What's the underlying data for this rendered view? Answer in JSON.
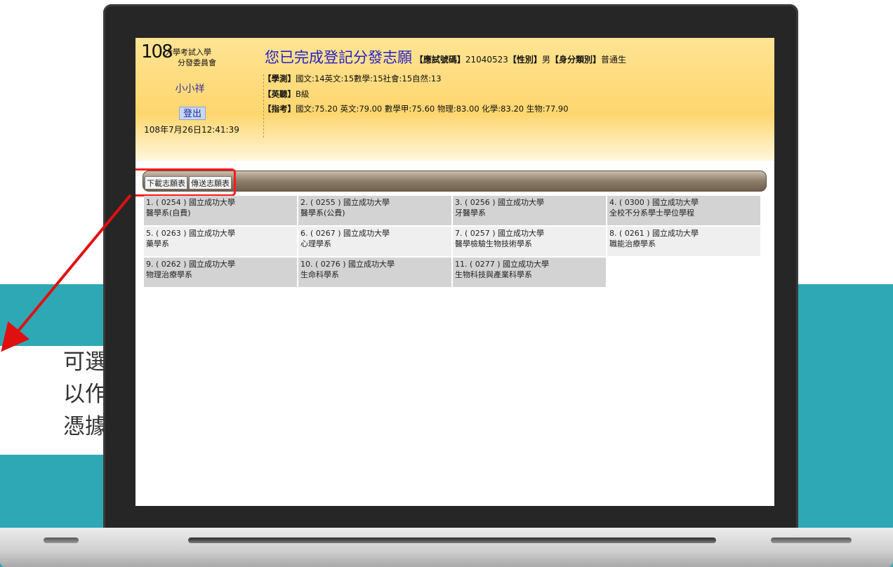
{
  "callout": {
    "lines": [
      "可選",
      "以作",
      "憑據"
    ]
  },
  "header": {
    "logo_number": "108",
    "logo_line1": "大學考試入學",
    "logo_line2": "分發委員會",
    "user_name": "小小祥",
    "logout_label": "登出",
    "datetime": "108年7月26日12:41:39",
    "title": "您已完成登記分發志願",
    "exam_no_label": "【應試號碼】",
    "exam_no": "21040523",
    "gender_label": "【性別】",
    "gender": "男",
    "category_label": "【身分類別】",
    "category": "普通生",
    "xuece_label": "【學測】",
    "xuece_scores": "國文:14英文:15數學:15社會:15自然:13",
    "listening_label": "【英聽】",
    "listening_grade": "B級",
    "zhike_label": "【指考】",
    "zhike_scores": "國文:75.20 英文:79.00 數學甲:75.60 物理:83.00 化學:83.20 生物:77.90"
  },
  "toolbar": {
    "download_label": "下載志願表",
    "send_label": "傳送志願表"
  },
  "choices": [
    {
      "line1": "1. ( 0254 ) 國立成功大學",
      "line2": "醫學系(自費)"
    },
    {
      "line1": "2. ( 0255 ) 國立成功大學",
      "line2": "醫學系(公費)"
    },
    {
      "line1": "3. ( 0256 ) 國立成功大學",
      "line2": "牙醫學系"
    },
    {
      "line1": "4. ( 0300 ) 國立成功大學",
      "line2": "全校不分系學士學位學程"
    },
    {
      "line1": "5. ( 0263 ) 國立成功大學",
      "line2": "藥學系"
    },
    {
      "line1": "6. ( 0267 ) 國立成功大學",
      "line2": "心理學系"
    },
    {
      "line1": "7. ( 0257 ) 國立成功大學",
      "line2": "醫學檢驗生物技術學系"
    },
    {
      "line1": "8. ( 0261 ) 國立成功大學",
      "line2": "職能治療學系"
    },
    {
      "line1": "9. ( 0262 ) 國立成功大學",
      "line2": "物理治療學系"
    },
    {
      "line1": "10. ( 0276 ) 國立成功大學",
      "line2": "生命科學系"
    },
    {
      "line1": "11. ( 0277 ) 國立成功大學",
      "line2": "生物科技與產業科學系"
    }
  ],
  "colors": {
    "teal": "#2ea8b4",
    "header_yellow": "#fdd66e",
    "title_blue": "#2320c9",
    "highlight_red": "#ff1a1a"
  }
}
